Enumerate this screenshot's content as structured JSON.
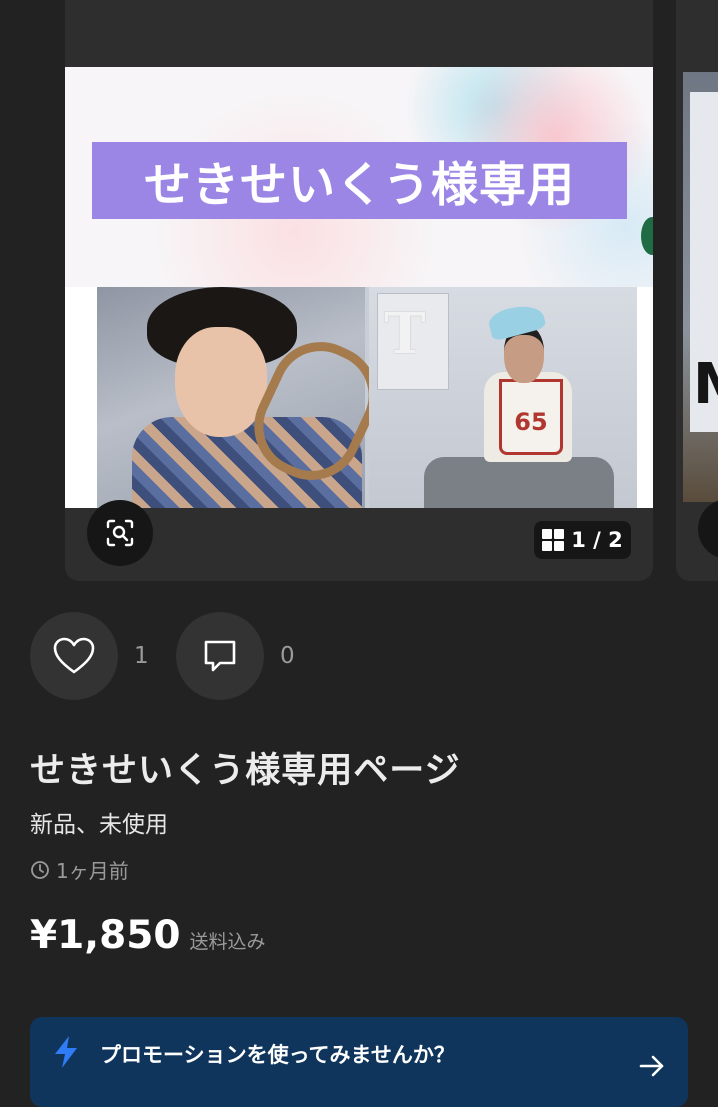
{
  "carousel": {
    "banner_text": "せきせいくう様専用",
    "jersey_number": "65",
    "magazine_letter": "T",
    "counter": "1 / 2",
    "next_card_letter": "M"
  },
  "actions": {
    "like_count": "1",
    "comment_count": "0"
  },
  "item": {
    "title": "せきせいくう様専用ページ",
    "condition": "新品、未使用",
    "posted": "1ヶ月前",
    "price": "¥1,850",
    "shipping": "送料込み"
  },
  "promo": {
    "text": "プロモーションを使ってみませんか？"
  },
  "colors": {
    "background": "#222222",
    "card": "#2e2e2e",
    "banner_label": "#9b86e6",
    "promo": "#0f355c",
    "promo_icon": "#2f7cf6"
  },
  "icons": [
    "zoom-scan-icon",
    "grid-icon",
    "heart-icon",
    "comment-icon",
    "clock-icon",
    "lightning-icon",
    "arrow-right-icon"
  ]
}
